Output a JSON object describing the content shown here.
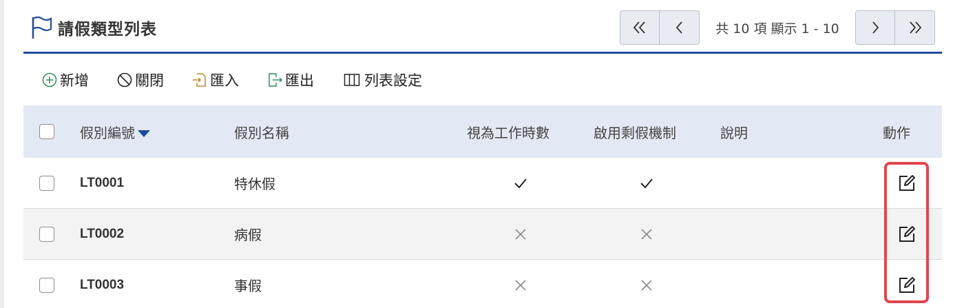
{
  "header": {
    "title": "請假類型列表",
    "pager_info": "共 10 項 顯示 1 - 10"
  },
  "toolbar": {
    "add": "新增",
    "close": "關閉",
    "import": "匯入",
    "export": "匯出",
    "list_settings": "列表設定"
  },
  "table": {
    "columns": {
      "code": "假別編號",
      "name": "假別名稱",
      "work_hours": "視為工作時數",
      "remaining_leave": "啟用剩假機制",
      "description": "說明",
      "action": "動作"
    },
    "rows": [
      {
        "code": "LT0001",
        "name": "特休假",
        "work_hours": true,
        "remaining_leave": true,
        "description": ""
      },
      {
        "code": "LT0002",
        "name": "病假",
        "work_hours": false,
        "remaining_leave": false,
        "description": ""
      },
      {
        "code": "LT0003",
        "name": "事假",
        "work_hours": false,
        "remaining_leave": false,
        "description": ""
      }
    ]
  },
  "colors": {
    "accent": "#1f4c99",
    "header_row_bg": "#e3e9f4",
    "highlight": "#e0444e",
    "add_green": "#2f8f5b",
    "import_orange": "#c7852a"
  }
}
